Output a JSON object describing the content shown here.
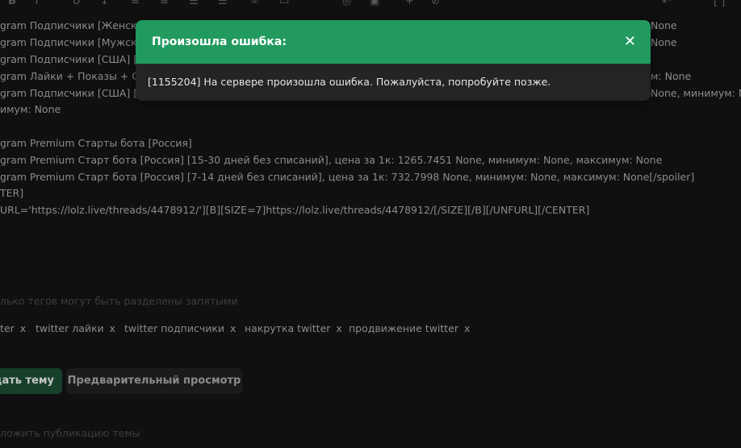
{
  "toolbar": {
    "icons": [
      "bold-icon",
      "italic-icon",
      "underline-icon",
      "strike-icon",
      "font-size-icon",
      "align-icon",
      "list-icon",
      "link-icon",
      "image-icon",
      "media-icon",
      "smile-icon",
      "picture-icon",
      "add-icon",
      "hide-icon"
    ],
    "right_icons": [
      "undo-icon",
      "fullscreen-icon"
    ]
  },
  "editor": {
    "line1": "gram Подписчики [Женски",
    "line1_right": "None",
    "line2": "gram Подписчики [Мужски",
    "line2_right": "None",
    "line3": "gram Подписчики [США] [",
    "line4": "gram Лайки + Показы + Ох",
    "line4_right": "м: None",
    "line5": "gram Подписчики [США] [",
    "line5_right": "None, минимум: None",
    "line6": "имум: None",
    "line7": "gram Premium Старты бота [Россия]",
    "line8": "gram Premium Старт бота [Россия] [15-30 дней без списаний], цена за 1к: 1265.7451 None, минимум: None, максимум: None",
    "line9": "gram Premium Старт бота [Россия] [7-14 дней без списаний], цена за 1к: 732.7998 None, минимум: None, максимум: None[/spoiler]",
    "line10": "TER]",
    "line11": "URL='https://lolz.live/threads/4478912/'][B][SIZE=7]https://lolz.live/threads/4478912/[/SIZE][/B][/UNFURL][/CENTER]"
  },
  "tags_hint": "лько тегов могут быть разделены запятыми",
  "tags": [
    {
      "label": "ter",
      "remove": "x"
    },
    {
      "label": "twitter лайки",
      "remove": "x"
    },
    {
      "label": "twitter подписчики",
      "remove": "x"
    },
    {
      "label": "накрутка twitter",
      "remove": "x"
    },
    {
      "label": "продвижение twitter",
      "remove": "x"
    }
  ],
  "buttons": {
    "create": "дать тему",
    "preview": "Предварительный просмотр"
  },
  "schedule_label": "ложить публикацию темы",
  "modal": {
    "title": "Произошла ошибка:",
    "close": "✕",
    "message": "[1155204] На сервере произошла ошибка. Пожалуйста, попробуйте позже."
  },
  "colors": {
    "accent": "#229a5f",
    "background": "#101010",
    "modal_body": "#242424"
  }
}
